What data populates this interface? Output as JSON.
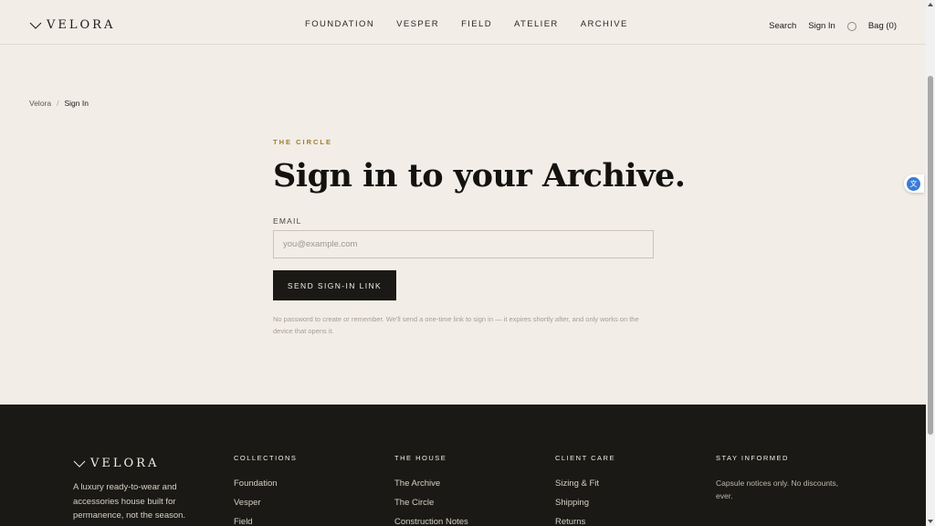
{
  "header": {
    "logo": "VELORA",
    "nav": [
      "FOUNDATION",
      "VESPER",
      "FIELD",
      "ATELIER",
      "ARCHIVE"
    ],
    "search": "Search",
    "sign_in": "Sign In",
    "bag": "Bag (0)"
  },
  "breadcrumb": {
    "home": "Velora",
    "separator": "/",
    "current": "Sign In"
  },
  "main": {
    "eyebrow": "THE CIRCLE",
    "title": "Sign in to your Archive.",
    "email_label": "EMAIL",
    "email_placeholder": "you@example.com",
    "email_value": "",
    "button": "SEND SIGN-IN LINK",
    "note": "No password to create or remember. We'll send a one-time link to sign in — it expires shortly after, and only works on the device that opens it."
  },
  "footer": {
    "logo": "VELORA",
    "description": "A luxury ready-to-wear and accessories house built for permanence, not the season.",
    "collections": {
      "heading": "COLLECTIONS",
      "links": [
        "Foundation",
        "Vesper",
        "Field"
      ]
    },
    "house": {
      "heading": "THE HOUSE",
      "links": [
        "The Archive",
        "The Circle",
        "Construction Notes"
      ]
    },
    "care": {
      "heading": "CLIENT CARE",
      "links": [
        "Sizing & Fit",
        "Shipping",
        "Returns"
      ]
    },
    "informed": {
      "heading": "STAY INFORMED",
      "text": "Capsule notices only. No discounts, ever."
    }
  },
  "icons": {
    "logo_mark": "chevron-mark-icon",
    "account": "circle-icon",
    "translate_widget": "translate-icon"
  },
  "colors": {
    "background": "#f2eee7",
    "accent": "#a27a2c",
    "dark": "#1b1915"
  }
}
